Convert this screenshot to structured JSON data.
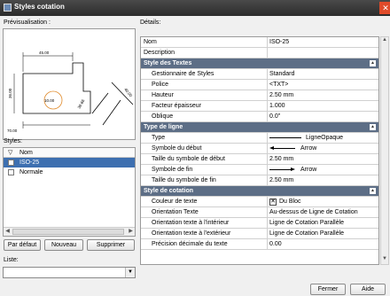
{
  "window": {
    "title": "Styles cotation",
    "close": "✕"
  },
  "preview": {
    "label": "Prévisualisation :",
    "dims": [
      "45.00",
      "36.00",
      "38.66",
      "10.00",
      "40.00",
      "70.00"
    ]
  },
  "styles": {
    "label": "Styles:",
    "column": "Nom",
    "items": [
      "ISO-25",
      "Normale"
    ],
    "selected_index": 0
  },
  "buttons": {
    "default": "Par défaut",
    "new": "Nouveau",
    "delete": "Supprimer",
    "ok": "Fermer",
    "help": "Aide"
  },
  "list_label": "Liste:",
  "details": {
    "label": "Détails:",
    "rows": [
      {
        "type": "prop",
        "k": "Nom",
        "v": "ISO-25"
      },
      {
        "type": "prop",
        "k": "Description",
        "v": ""
      },
      {
        "type": "section",
        "k": "Style des Textes"
      },
      {
        "type": "prop",
        "k": "Gestionnaire de Styles",
        "v": "Standard",
        "ind": true
      },
      {
        "type": "prop",
        "k": "Police",
        "v": "<TXT>",
        "ind": true
      },
      {
        "type": "prop",
        "k": "Hauteur",
        "v": "2.50 mm",
        "ind": true
      },
      {
        "type": "prop",
        "k": "Facteur épaisseur",
        "v": "1.000",
        "ind": true
      },
      {
        "type": "prop",
        "k": "Oblique",
        "v": "0.0\"",
        "ind": true
      },
      {
        "type": "section",
        "k": "Type de ligne"
      },
      {
        "type": "prop",
        "k": "Type",
        "v": "LigneOpaque",
        "ind": true,
        "sample": "line"
      },
      {
        "type": "prop",
        "k": "Symbole du début",
        "v": "Arrow",
        "ind": true,
        "sample": "arrow-left"
      },
      {
        "type": "prop",
        "k": "Taille du symbole de début",
        "v": "2.50 mm",
        "ind": true
      },
      {
        "type": "prop",
        "k": "Symbole de fin",
        "v": "Arrow",
        "ind": true,
        "sample": "arrow-right"
      },
      {
        "type": "prop",
        "k": "Taille du symbole de fin",
        "v": "2.50 mm",
        "ind": true
      },
      {
        "type": "section",
        "k": "Style de cotation"
      },
      {
        "type": "prop",
        "k": "Couleur de texte",
        "v": "Du Bloc",
        "ind": true,
        "sample": "checkbox"
      },
      {
        "type": "prop",
        "k": "Orientation Texte",
        "v": "Au-dessus de Ligne de Cotation",
        "ind": true
      },
      {
        "type": "prop",
        "k": "Orientation texte à l'intérieur",
        "v": "Ligne de Cotation Parallèle",
        "ind": true
      },
      {
        "type": "prop",
        "k": "Orientation texte à l'extérieur",
        "v": "Ligne de Cotation Parallèle",
        "ind": true
      },
      {
        "type": "prop",
        "k": "Précision décimale du texte",
        "v": "0.00",
        "ind": true
      }
    ]
  },
  "icons": [
    "app-icon",
    "close-icon",
    "filter-icon",
    "collapse-icon",
    "dropdown-arrow-icon",
    "scroll-up-icon",
    "scroll-down-icon"
  ]
}
